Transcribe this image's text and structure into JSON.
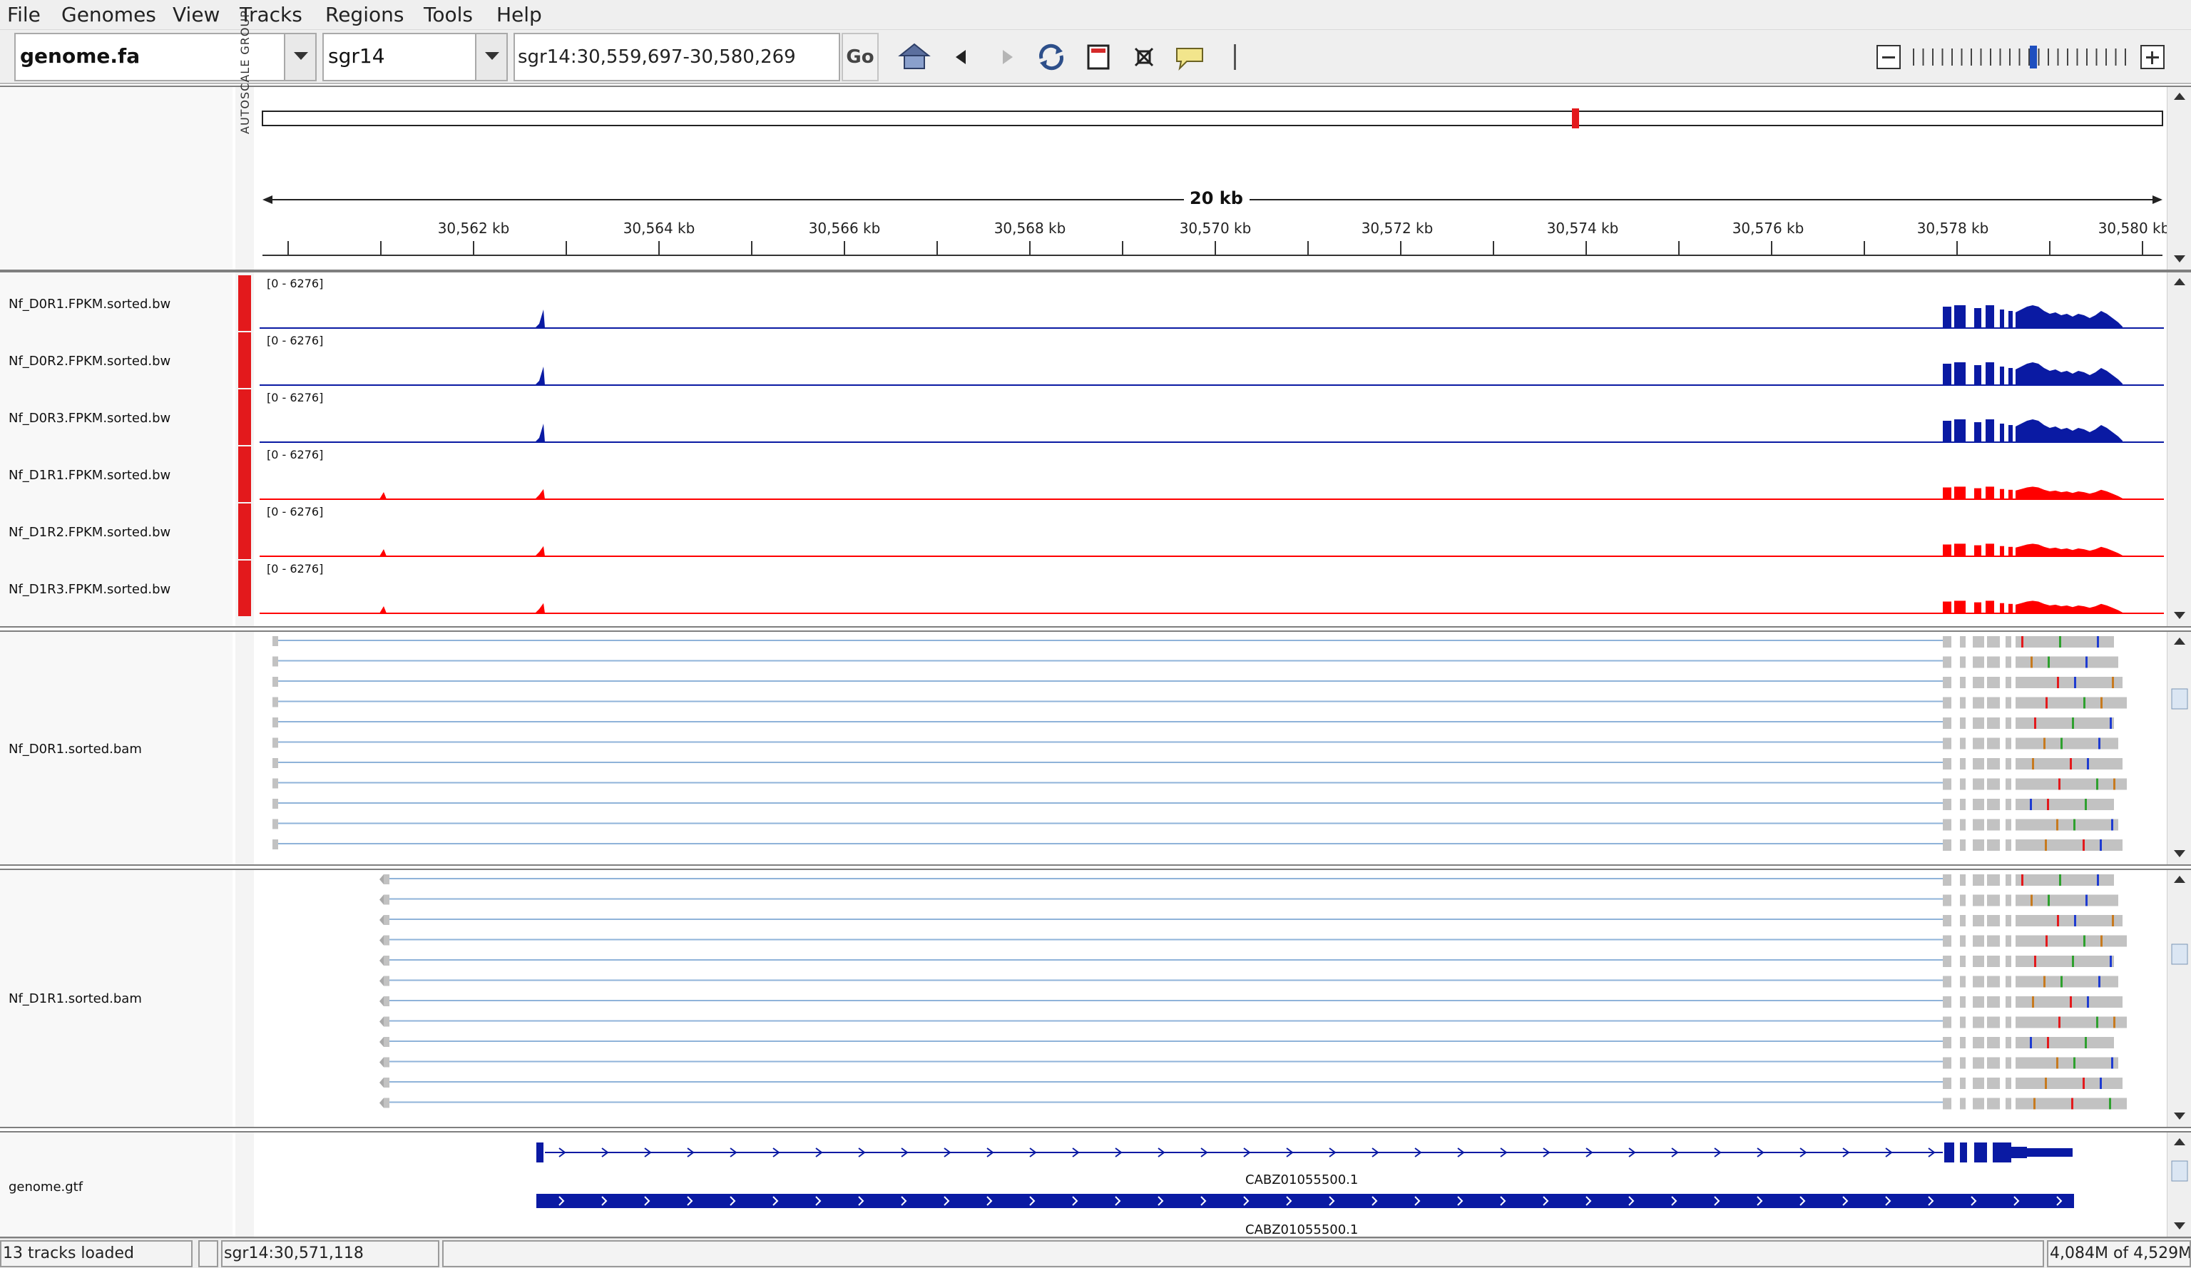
{
  "menu": [
    "File",
    "Genomes",
    "View",
    "Tracks",
    "Regions",
    "Tools",
    "Help"
  ],
  "toolbar": {
    "genome": "genome.fa",
    "chromosome": "sgr14",
    "locus": "sgr14:30,559,697-30,580,269",
    "go_label": "Go"
  },
  "ruler": {
    "span_label": "20 kb",
    "autoscale_label": "AUTOSCALE GROUP",
    "ticks": [
      "30,562 kb",
      "30,564 kb",
      "30,566 kb",
      "30,568 kb",
      "30,570 kb",
      "30,572 kb",
      "30,574 kb",
      "30,576 kb",
      "30,578 kb",
      "30,580 kb"
    ]
  },
  "tracks": {
    "coverage": [
      {
        "name": "Nf_D0R1.FPKM.sorted.bw",
        "range": "[0 - 6276]",
        "color": "#0a1aa3"
      },
      {
        "name": "Nf_D0R2.FPKM.sorted.bw",
        "range": "[0 - 6276]",
        "color": "#0a1aa3"
      },
      {
        "name": "Nf_D0R3.FPKM.sorted.bw",
        "range": "[0 - 6276]",
        "color": "#0a1aa3"
      },
      {
        "name": "Nf_D1R1.FPKM.sorted.bw",
        "range": "[0 - 6276]",
        "color": "#ff0000"
      },
      {
        "name": "Nf_D1R2.FPKM.sorted.bw",
        "range": "[0 - 6276]",
        "color": "#ff0000"
      },
      {
        "name": "Nf_D1R3.FPKM.sorted.bw",
        "range": "[0 - 6276]",
        "color": "#ff0000"
      }
    ],
    "alignments": [
      {
        "name": "Nf_D0R1.sorted.bam"
      },
      {
        "name": "Nf_D1R1.sorted.bam"
      }
    ],
    "annotation": {
      "name": "genome.gtf",
      "gene_label_1": "CABZ01055500.1",
      "gene_label_2": "CABZ01055500.1",
      "color": "#0a1aa3"
    }
  },
  "status": {
    "tracks_loaded": "13 tracks loaded",
    "position": "sgr14:30,571,118",
    "memory": "4,084M of 4,529M"
  },
  "colors": {
    "attribute_red": "#e3191c",
    "read_gray": "#c2c2c2",
    "junction_line": "#8fb3d9"
  }
}
